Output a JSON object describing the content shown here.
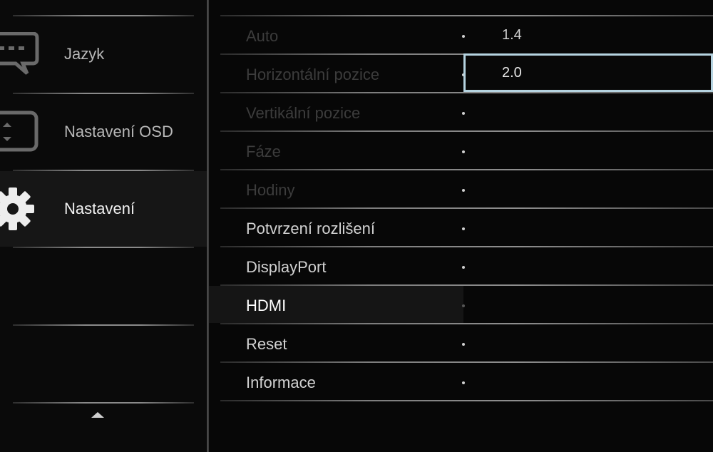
{
  "sidebar": {
    "items": [
      {
        "label": "Jazyk",
        "icon": "speech-bubble-icon",
        "active": false
      },
      {
        "label": "Nastavení OSD",
        "icon": "osd-frame-icon",
        "active": false
      },
      {
        "label": "Nastavení",
        "icon": "gear-icon",
        "active": true
      }
    ],
    "scroll_icon": "chevron-up-icon"
  },
  "menu": {
    "items": [
      {
        "label": "Auto",
        "enabled": false
      },
      {
        "label": "Horizontální pozice",
        "enabled": false
      },
      {
        "label": "Vertikální pozice",
        "enabled": false
      },
      {
        "label": "Fáze",
        "enabled": false
      },
      {
        "label": "Hodiny",
        "enabled": false
      },
      {
        "label": "Potvrzení rozlišení",
        "enabled": true
      },
      {
        "label": "DisplayPort",
        "enabled": true
      },
      {
        "label": "HDMI",
        "enabled": true,
        "selected": true
      },
      {
        "label": "Reset",
        "enabled": true
      },
      {
        "label": "Informace",
        "enabled": true
      }
    ]
  },
  "submenu": {
    "options": [
      {
        "label": "1.4",
        "selected": false
      },
      {
        "label": "2.0",
        "selected": true
      }
    ]
  },
  "colors": {
    "selection_border": "#b5d3e0",
    "background": "#070707",
    "disabled_text": "#3c3c3c"
  }
}
